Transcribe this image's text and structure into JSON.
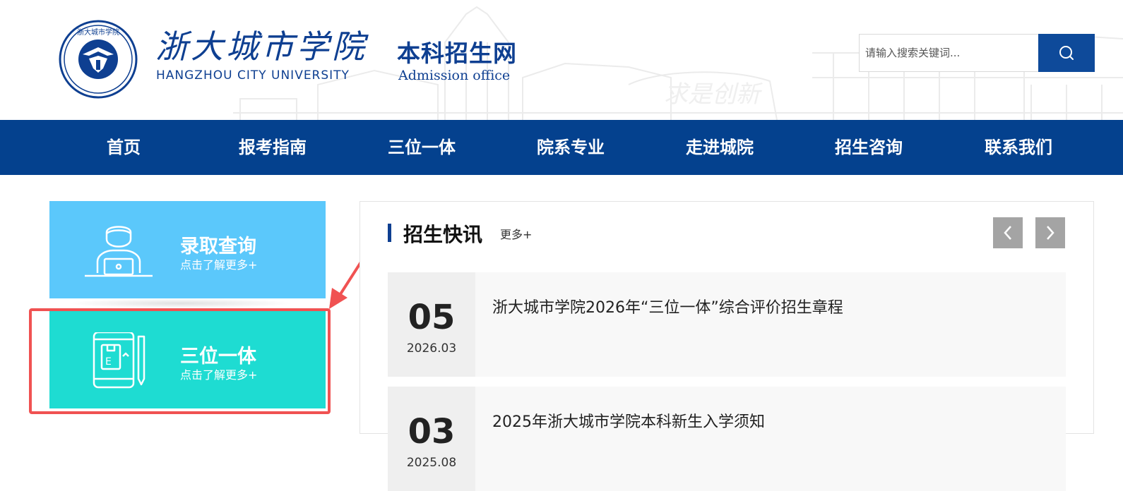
{
  "header": {
    "logo_cn": "浙大城市学院",
    "logo_en": "HANGZHOU CITY UNIVERSITY",
    "seal_text": "浙大城市学院 HANGZHOU CITY UNIVERSITY",
    "site_cn": "本科招生网",
    "site_en": "Admission office",
    "bg_motto": "求是创新",
    "search_placeholder": "请输入搜索关键词..."
  },
  "nav": {
    "items": [
      {
        "label": "首页"
      },
      {
        "label": "报考指南"
      },
      {
        "label": "三位一体"
      },
      {
        "label": "院系专业"
      },
      {
        "label": "走进城院"
      },
      {
        "label": "招生咨询"
      },
      {
        "label": "联系我们"
      }
    ]
  },
  "cards": [
    {
      "title": "录取查询",
      "sub": "点击了解更多+",
      "icon": "user-laptop-icon",
      "color": "#5bc8fb"
    },
    {
      "title": "三位一体",
      "sub": "点击了解更多+",
      "icon": "tablet-document-icon",
      "color": "#1edcd2"
    }
  ],
  "news": {
    "title": "招生快讯",
    "more": "更多+",
    "items": [
      {
        "day": "05",
        "ym": "2026.03",
        "title": "浙大城市学院2026年“三位一体”综合评价招生章程"
      },
      {
        "day": "03",
        "ym": "2025.08",
        "title": "2025年浙大城市学院本科新生入学须知"
      }
    ]
  },
  "colors": {
    "brand": "#04418e",
    "highlight": "#f05252"
  }
}
